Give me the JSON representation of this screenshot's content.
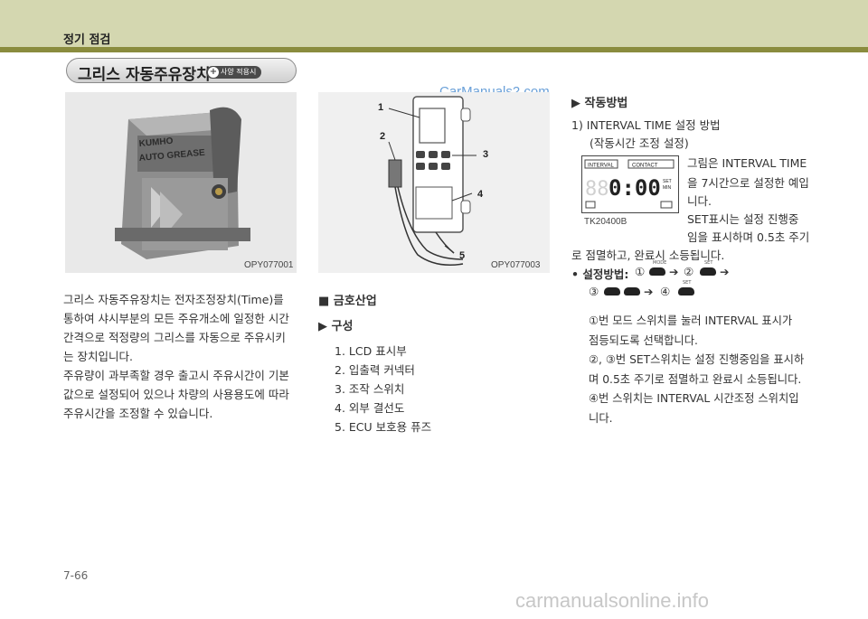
{
  "header": {
    "title": "정기 점검"
  },
  "section": {
    "title": "그리스 자동주유장치",
    "option_badge": "사양 적용시",
    "badge_icon": "+"
  },
  "watermarks": {
    "top": "CarManuals2.com",
    "bottom": "carmanualsonline.info"
  },
  "figures": {
    "left_code": "OPY077001",
    "middle_code": "OPY077003",
    "right_code": "TK20400B",
    "callouts": [
      "1",
      "2",
      "3",
      "4",
      "5"
    ],
    "lcd": {
      "interval": "INTERVAL",
      "contact": "CONTACT",
      "set": "SET",
      "min": "MIN",
      "digits": "0:00"
    },
    "label_on_device": [
      "KUMHO",
      "AUTO GREASE"
    ]
  },
  "left_text": {
    "lines": [
      "그리스 자동주유장치는 전자조정장치(Time)를",
      "통하여 샤시부분의 모든 주유개소에 일정한 시간",
      "간격으로 적정량의 그리스를 자동으로 주유시키",
      "는 장치입니다.",
      "주유량이 과부족할 경우 출고시 주유시간이 기본",
      "값으로 설정되어 있으나 차량의 사용용도에 따라",
      "주유시간을 조정할 수 있습니다."
    ]
  },
  "middle_text": {
    "company": "■ 금호산업",
    "section": "▶ 구성",
    "items": [
      "1.  LCD 표시부",
      "2.  입출력 커넥터",
      "3.  조작 스위치",
      "4.  외부 결선도",
      "5.  ECU 보호용 퓨즈"
    ]
  },
  "right_text": {
    "heading": "▶ 작동방법",
    "step1": "1)  INTERVAL TIME 설정 방법",
    "step1_sub": "(작동시간 조정 설정)",
    "desc_lines": [
      "그림은 INTERVAL TIME",
      "을 7시간으로 설정한 예입",
      "니다.",
      "SET표시는 설정 진행중",
      "임을 표시하며 0.5초 주기"
    ],
    "desc_tail": "로 점멸하고, 완료시 소등됩니다.",
    "method_label": "•  설정방법:",
    "method_row1": [
      "①",
      "➔",
      "②",
      "➔"
    ],
    "method_row2": [
      "③",
      "➔",
      "④"
    ],
    "button_labels": {
      "mode": "MODE",
      "set": "SET"
    },
    "notes": [
      "①번 모드 스위치를 눌러 INTERVAL 표시가",
      "점등되도록 선택합니다.",
      "②, ③번 SET스위치는 설정 진행중임을 표시하",
      "며 0.5초 주기로 점멸하고 완료시 소등됩니다.",
      "④번 스위치는 INTERVAL 시간조정 스위치입",
      "니다."
    ]
  },
  "footer": {
    "page": "7-66"
  }
}
